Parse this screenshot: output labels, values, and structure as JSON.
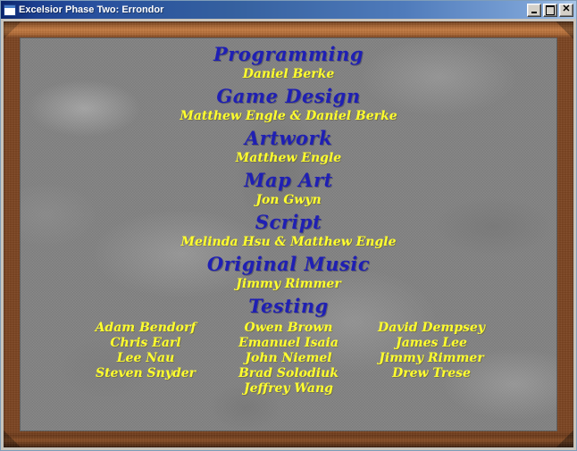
{
  "window": {
    "title": "Excelsior Phase Two: Errondor",
    "icon": "window-document-icon",
    "buttons": [
      {
        "name": "minimize",
        "glyph": "_"
      },
      {
        "name": "maximize",
        "glyph": "□"
      },
      {
        "name": "close",
        "glyph": "✕"
      }
    ]
  },
  "theme": {
    "titlebar_start": "#0a246a",
    "titlebar_end": "#a8c6e8",
    "frame_wood": "#c47c44",
    "stone_bg": "#838383",
    "heading_color": "#1f1fb4",
    "name_color": "#ffff2e"
  },
  "credits": {
    "sections": [
      {
        "heading": "Programming",
        "lines": [
          "Daniel Berke"
        ]
      },
      {
        "heading": "Game Design",
        "lines": [
          "Matthew Engle & Daniel Berke"
        ]
      },
      {
        "heading": "Artwork",
        "lines": [
          "Matthew Engle"
        ]
      },
      {
        "heading": "Map Art",
        "lines": [
          "Jon Gwyn"
        ]
      },
      {
        "heading": "Script",
        "lines": [
          "Melinda Hsu & Matthew Engle"
        ]
      },
      {
        "heading": "Original Music",
        "lines": [
          "Jimmy Rimmer"
        ]
      }
    ],
    "testing": {
      "heading": "Testing",
      "columns": [
        [
          "Adam Bendorf",
          "Chris Earl",
          "Lee Nau",
          "Steven Snyder"
        ],
        [
          "Owen Brown",
          "Emanuel Isaia",
          "John Niemel",
          "Brad Solodiuk",
          "Jeffrey Wang"
        ],
        [
          "David Dempsey",
          "James Lee",
          "Jimmy Rimmer",
          "Drew Trese"
        ]
      ]
    }
  }
}
